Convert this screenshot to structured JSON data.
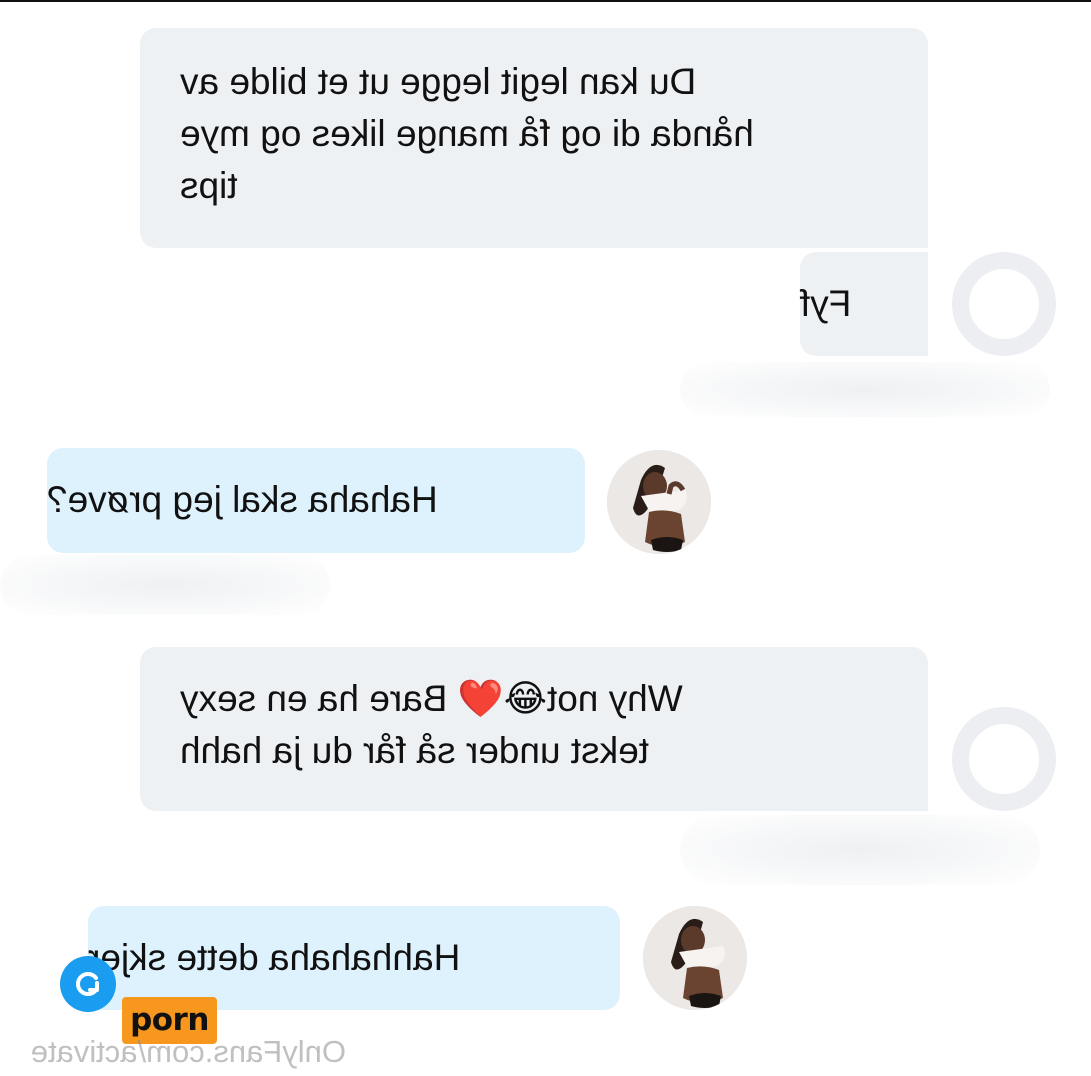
{
  "messages": [
    {
      "text": "Du kan legit legge ut et bilde av\nhånda di og få mange likes og mye\ntips",
      "sender": "other"
    },
    {
      "text": "Fyf",
      "sender": "other"
    },
    {
      "text": "Hahaha skal jeg prøve?",
      "sender": "self"
    },
    {
      "text": "Why not😂❤️ Bare ha en sexy\ntekst under så får du ja hahh",
      "sender": "other"
    },
    {
      "text": "Hahhahaha dette skjer",
      "sender": "self"
    }
  ],
  "badge": {
    "label": "porn"
  },
  "watermark": {
    "text": "OnlyFans.com/activate"
  },
  "icons": {
    "reply": "reply-arrow-icon",
    "avatar_placeholder": "avatar-ring-icon",
    "avatar_photo": "user-avatar"
  },
  "colors": {
    "bubble_grey": "#eef1f4",
    "bubble_blue": "#def2fd",
    "reply_button": "#1a9df0",
    "badge": "#f7971e"
  }
}
